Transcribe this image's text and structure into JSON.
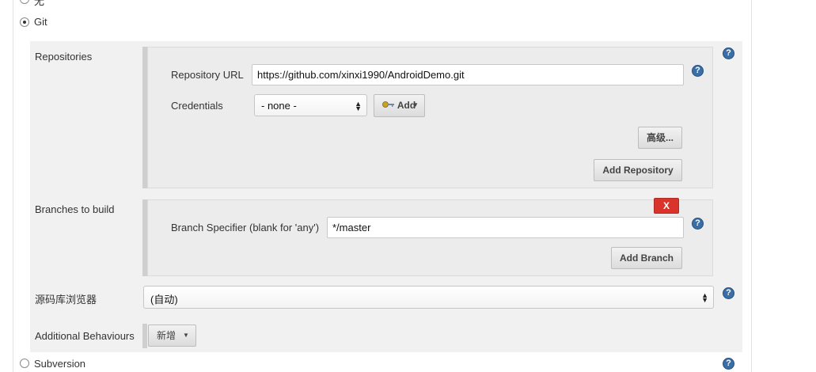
{
  "scm_options": {
    "none_label": "无",
    "git_label": "Git",
    "subversion_label": "Subversion"
  },
  "repositories": {
    "section_label": "Repositories",
    "url_label": "Repository URL",
    "url_value": "https://github.com/xinxi1990/AndroidDemo.git",
    "credentials_label": "Credentials",
    "credentials_selected": "- none -",
    "add_credentials_label": "Add",
    "advanced_label": "高级...",
    "add_repository_label": "Add Repository"
  },
  "branches": {
    "section_label": "Branches to build",
    "delete_label": "X",
    "specifier_label": "Branch Specifier (blank for 'any')",
    "specifier_value": "*/master",
    "add_branch_label": "Add Branch"
  },
  "browser": {
    "label": "源码库浏览器",
    "selected": "(自动)"
  },
  "behaviours": {
    "label": "Additional Behaviours",
    "add_label": "新增"
  },
  "help_glyph": "?",
  "colors": {
    "help_blue": "#3a6ea5",
    "delete_red": "#d9342b"
  }
}
